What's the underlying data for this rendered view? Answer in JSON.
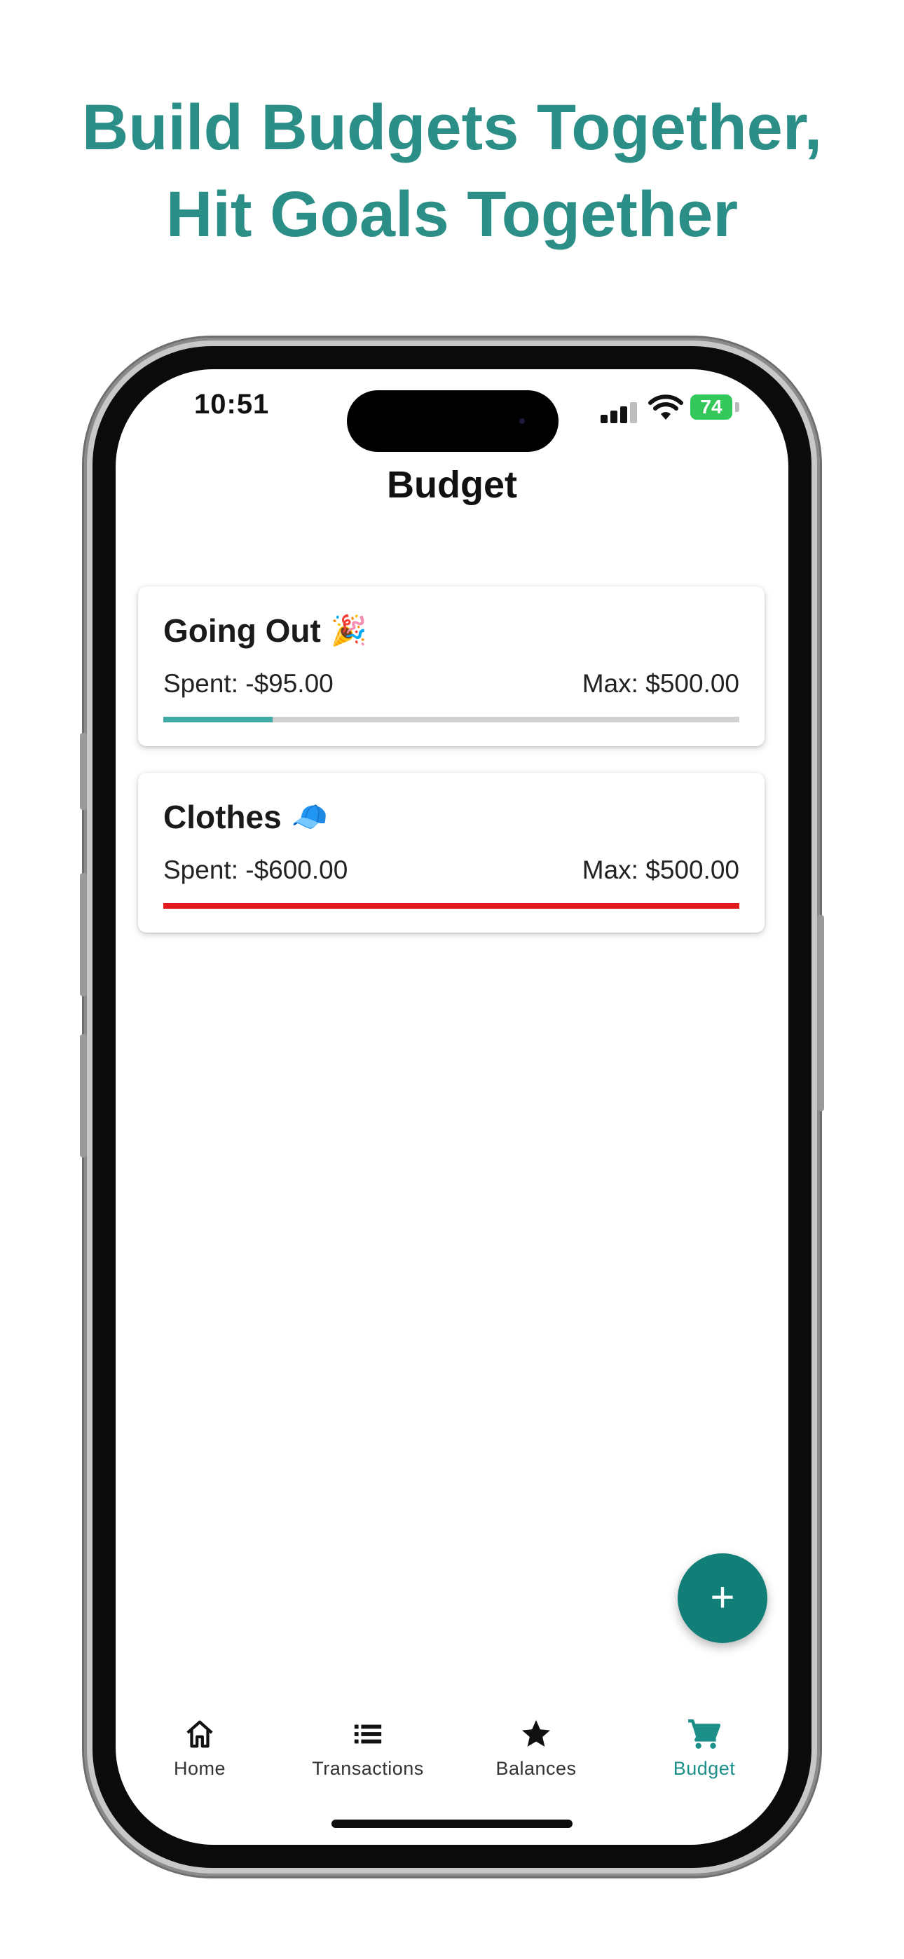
{
  "headline": {
    "line1": "Build Budgets Together,",
    "line2": "Hit Goals Together"
  },
  "status_bar": {
    "time": "10:51",
    "battery": "74"
  },
  "header": {
    "title": "Budget"
  },
  "budgets": [
    {
      "name": "Going Out",
      "emoji": "🎉",
      "spent": "Spent: -$95.00",
      "max": "Max: $500.00",
      "progress": 0.19,
      "bar_color": "#3fa9a3"
    },
    {
      "name": "Clothes",
      "emoji": "🧢",
      "spent": "Spent: -$600.00",
      "max": "Max: $500.00",
      "progress": 1.0,
      "bar_color": "#e01b1b"
    }
  ],
  "fab": {
    "icon": "plus-icon",
    "label": "+"
  },
  "bottom_nav": {
    "items": [
      {
        "label": "Home",
        "icon": "home-icon",
        "active": false
      },
      {
        "label": "Transactions",
        "icon": "list-icon",
        "active": false
      },
      {
        "label": "Balances",
        "icon": "star-icon",
        "active": false
      },
      {
        "label": "Budget",
        "icon": "cart-icon",
        "active": true
      }
    ]
  },
  "colors": {
    "accent": "#2b8f88",
    "fab": "#117f78",
    "over_budget": "#e01b1b"
  }
}
